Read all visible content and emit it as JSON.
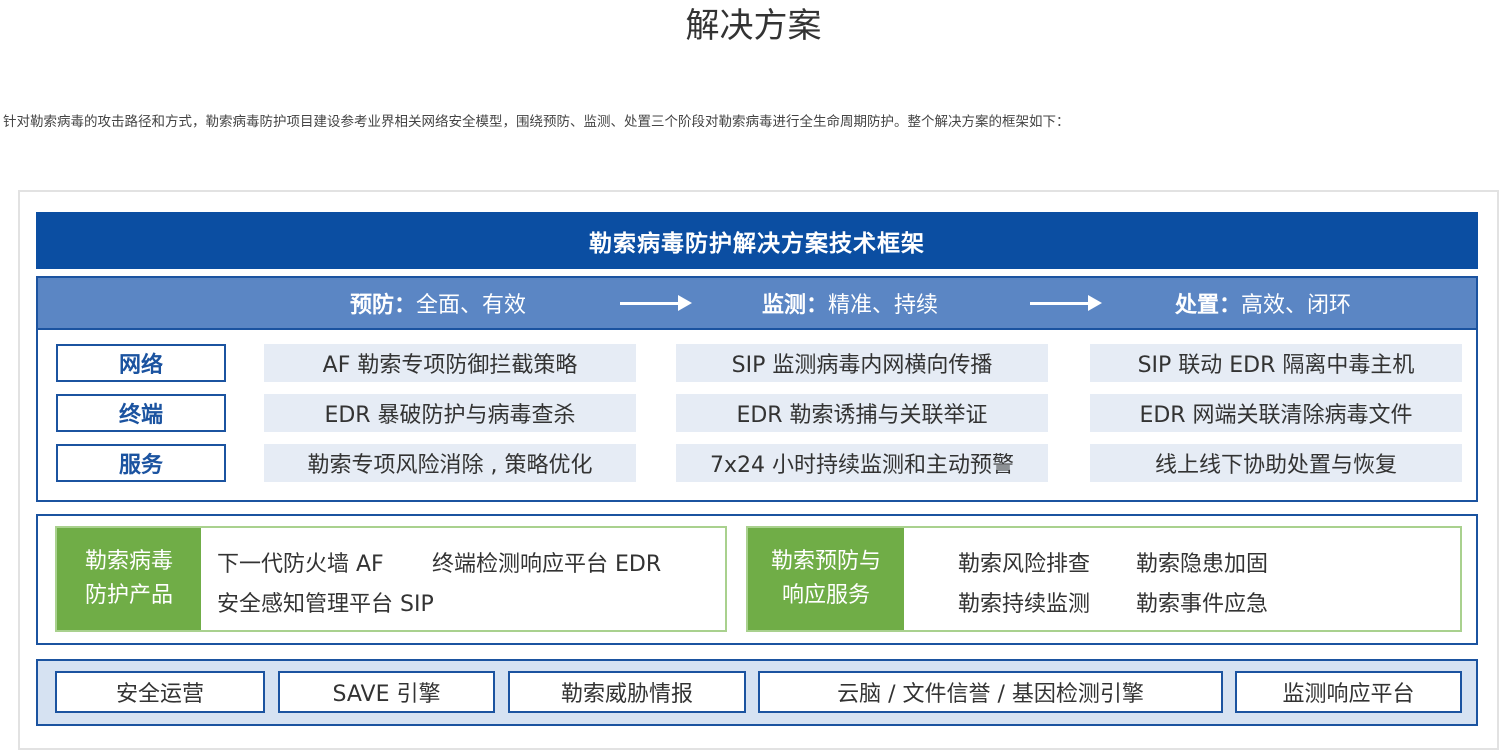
{
  "page": {
    "title": "解决方案",
    "intro": "针对勒索病毒的攻击路径和方式，勒索病毒防护项目建设参考业界相关网络安全模型，围绕预防、监测、处置三个阶段对勒索病毒进行全生命周期防护。整个解决方案的框架如下："
  },
  "diagram": {
    "banner": "勒索病毒防护解决方案技术框架",
    "phases": [
      {
        "name": "预防：",
        "desc": "全面、有效"
      },
      {
        "name": "监测：",
        "desc": "精准、持续"
      },
      {
        "name": "处置：",
        "desc": "高效、闭环"
      }
    ],
    "rows": [
      {
        "label": "网络",
        "cells": [
          "AF 勒索专项防御拦截策略",
          "SIP 监测病毒内网横向传播",
          "SIP 联动 EDR 隔离中毒主机"
        ]
      },
      {
        "label": "终端",
        "cells": [
          "EDR 暴破防护与病毒查杀",
          "EDR 勒索诱捕与关联举证",
          "EDR 网端关联清除病毒文件"
        ]
      },
      {
        "label": "服务",
        "cells": [
          "勒索专项风险消除 , 策略优化",
          "7x24 小时持续监测和主动预警",
          "线上线下协助处置与恢复"
        ]
      }
    ],
    "products": {
      "head_line1": "勒索病毒",
      "head_line2": "防护产品",
      "items": [
        "下一代防火墙 AF",
        "终端检测响应平台 EDR",
        "安全感知管理平台 SIP"
      ]
    },
    "services": {
      "head_line1": "勒索预防与",
      "head_line2": "响应服务",
      "items": [
        "勒索风险排查",
        "勒索隐患加固",
        "勒索持续监测",
        "勒索事件应急"
      ]
    },
    "platform": [
      "安全运营",
      "SAVE 引擎",
      "勒索威胁情报",
      "云脑 / 文件信誉 / 基因检测引擎",
      "监测响应平台"
    ],
    "colors": {
      "banner": "#0b4ea2",
      "phase_bar": "#5b86c4",
      "border": "#1b53a0",
      "cell_bg": "#e6ecf5",
      "green": "#70ad47",
      "platform_bg": "#d6e2f2"
    }
  }
}
